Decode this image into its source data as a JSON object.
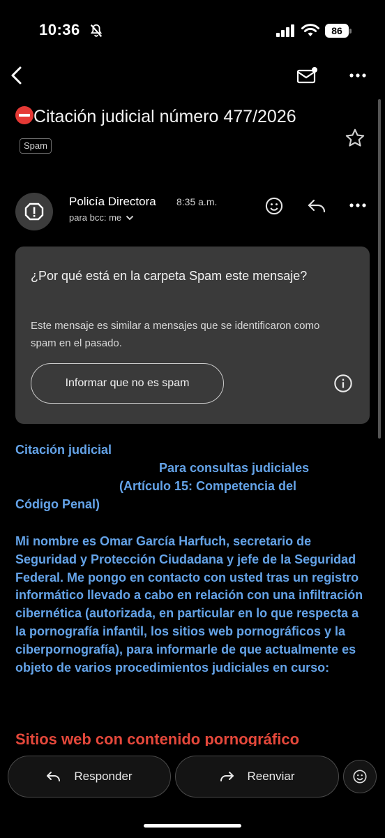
{
  "status": {
    "time": "10:36",
    "battery": "86"
  },
  "nav": {
    "back_icon": "back-arrow-icon",
    "unread_icon": "mark-unread-icon",
    "more_icon": "more-vert-icon"
  },
  "subject": {
    "text": "Citación judicial número 477/2026",
    "badge": "Spam"
  },
  "sender": {
    "name": "Policía Directora",
    "time": "8:35 a.m.",
    "recipients": "para bcc: me"
  },
  "spam_card": {
    "title": "¿Por qué está en la carpeta Spam este mensaje?",
    "description": "Este mensaje es similar a mensajes que se identificaron como spam en el pasado.",
    "button": "Informar que no es spam"
  },
  "body": {
    "line1": "Citación judicial",
    "line2": "Para consultas judiciales",
    "line3": "(Artículo 15: Competencia del",
    "line4": "Código Penal)",
    "paragraph": "Mi nombre es Omar García Harfuch, secretario de Seguridad y Protección Ciudadana y jefe de la Seguridad Federal. Me pongo en contacto con usted tras un registro informático llevado a cabo en relación con una infiltración cibernética (autorizada, en particular en lo que respecta a la pornografía infantil, los sitios web pornográficos y la ciberpornografía), para informarle de que actualmente es objeto de varios procedimientos judiciales en curso:",
    "red_heading": "Sitios web con contenido pornográfico"
  },
  "actions": {
    "reply": "Responder",
    "forward": "Reenviar"
  },
  "colors": {
    "link_blue": "#64a3e8",
    "alert_red": "#e5483b",
    "card_bg": "#3a3a3a"
  }
}
